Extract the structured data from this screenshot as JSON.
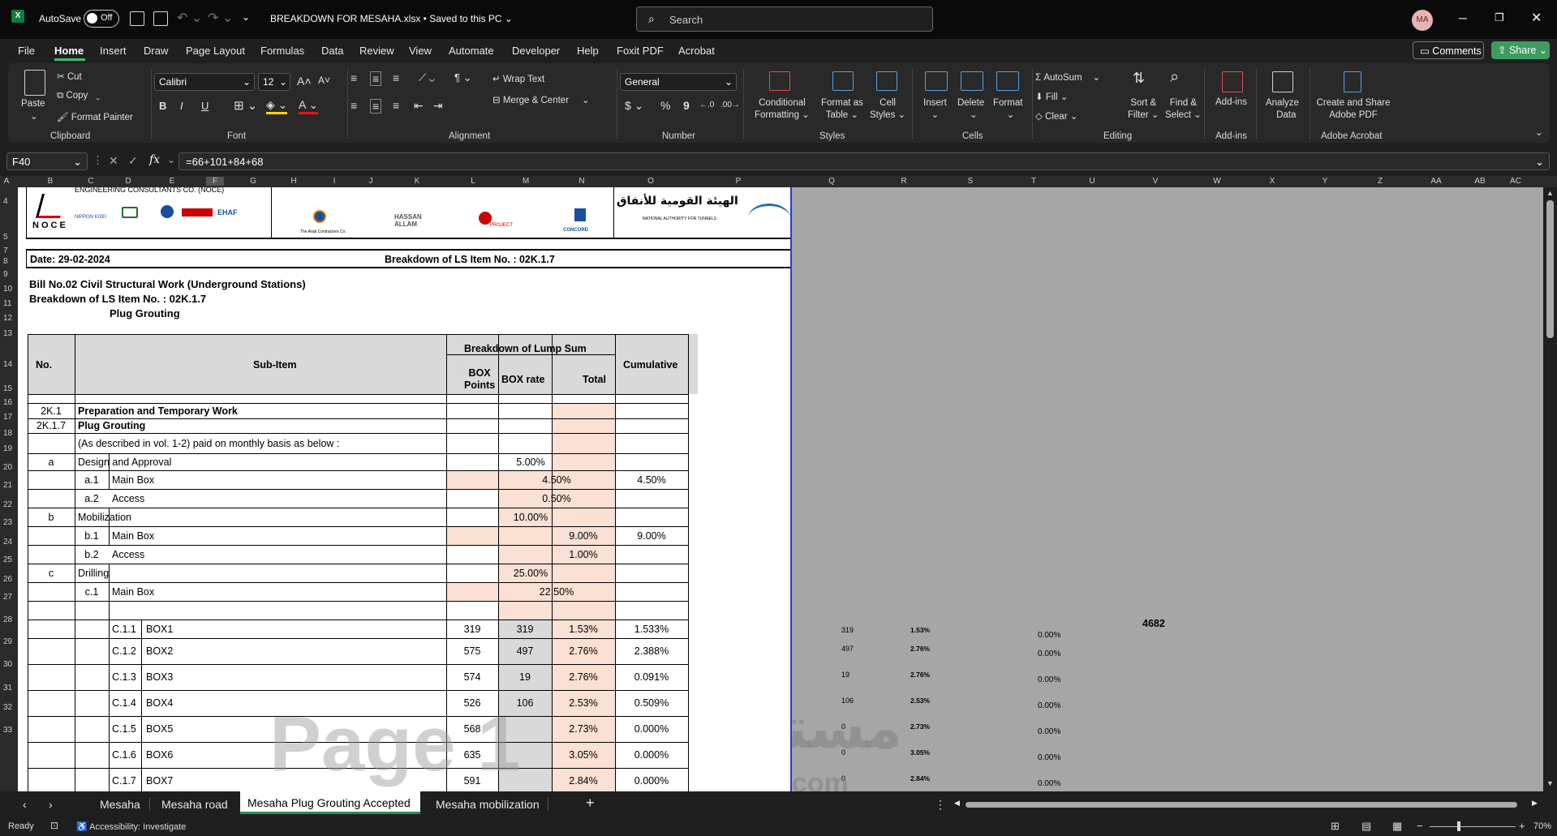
{
  "titlebar": {
    "autosave": "AutoSave",
    "toggle": "Off",
    "filename": "BREAKDOWN FOR MESAHA.xlsx • Saved to this PC ⌄",
    "search": "Search",
    "user": "MA"
  },
  "menu": {
    "tabs": [
      "File",
      "Home",
      "Insert",
      "Draw",
      "Page Layout",
      "Formulas",
      "Data",
      "Review",
      "View",
      "Automate",
      "Developer",
      "Help",
      "Foxit PDF",
      "Acrobat"
    ],
    "comments": "Comments",
    "share": "Share"
  },
  "ribbon": {
    "clipboard": {
      "paste": "Paste",
      "cut": "Cut",
      "copy": "Copy",
      "format_painter": "Format Painter",
      "group": "Clipboard"
    },
    "font": {
      "name": "Calibri",
      "size": "12",
      "bold": "B",
      "italic": "I",
      "underline": "U",
      "group": "Font"
    },
    "alignment": {
      "wrap": "Wrap Text",
      "merge": "Merge & Center",
      "group": "Alignment"
    },
    "number": {
      "format": "General",
      "currency": "$",
      "percent": "%",
      "comma": "9",
      "group": "Number"
    },
    "styles": {
      "conditional": "Conditional",
      "conditional2": "Formatting",
      "format_table": "Format as",
      "format_table2": "Table",
      "cell_styles": "Cell",
      "cell_styles2": "Styles",
      "group": "Styles"
    },
    "cells": {
      "insert": "Insert",
      "delete": "Delete",
      "format": "Format",
      "group": "Cells"
    },
    "editing": {
      "autosum": "AutoSum",
      "fill": "Fill",
      "clear": "Clear",
      "sort": "Sort &",
      "sort2": "Filter",
      "find": "Find &",
      "find2": "Select",
      "group": "Editing"
    },
    "addins": {
      "label": "Add-ins",
      "group": "Add-ins"
    },
    "analyze": {
      "label": "Analyze",
      "label2": "Data"
    },
    "acrobat": {
      "label": "Create and Share",
      "label2": "Adobe PDF",
      "group": "Adobe Acrobat"
    }
  },
  "formula_bar": {
    "cell_ref": "F40",
    "fx": "fx",
    "formula": "=66+101+84+68"
  },
  "columns": [
    "A",
    "B",
    "C",
    "D",
    "E",
    "F",
    "G",
    "H",
    "I",
    "J",
    "K",
    "L",
    "M",
    "N",
    "O",
    "P",
    "Q",
    "R",
    "S",
    "T",
    "U",
    "V",
    "W",
    "X",
    "Y",
    "Z",
    "AA",
    "AB",
    "AC"
  ],
  "rows": [
    "4",
    "5",
    "7",
    "8",
    "9",
    "10",
    "11",
    "12",
    "13",
    "14",
    "15",
    "16",
    "17",
    "18",
    "19",
    "20",
    "21",
    "22",
    "23",
    "24",
    "25",
    "26",
    "27",
    "28",
    "29",
    "30",
    "31",
    "32",
    "33"
  ],
  "sheet": {
    "logos": {
      "noce": "NOCE",
      "nippon": "NIPPON KOEI",
      "ehaf": "EHAF",
      "arab": "The Arab Contractors Co.",
      "hassan": "HASSAN ALLAM",
      "project": "PROJECT",
      "concord": "CONCORD",
      "nat_ar": "الهيئة القومية للأنفاق",
      "nat_en": "NATIONAL AUTHORITY FOR TUNNELS",
      "top_text": "ENGINEERING CONSULTANTS CO. (NOCE)"
    },
    "date": "Date: 29-02-2024",
    "breakdown_title": "Breakdown of LS Item No. : 02K.1.7",
    "bill": "Bill No.02 Civil Structural Work (Underground Stations)",
    "breakdown_line": "Breakdown of LS Item No. : 02K.1.7",
    "plug": "Plug Grouting",
    "headers": {
      "no": "No.",
      "subitem": "Sub-Item",
      "lump": "Breakdown of Lump Sum",
      "box_points": "BOX",
      "box_points2": "Points",
      "box_rate": "BOX rate",
      "total": "Total",
      "cumulative": "Cumulative"
    },
    "r16": {
      "no": "2K.1",
      "desc": "Preparation and Temporary Work"
    },
    "r17": {
      "no": "2K.1.7",
      "desc": "Plug Grouting"
    },
    "r18": {
      "desc": "(As described in vol. 1-2) paid on monthly basis as below :"
    },
    "r19": {
      "no": "a",
      "desc": "Design and Approval",
      "pct": "5.00%"
    },
    "r20": {
      "no": "a.1",
      "desc": "Main Box",
      "total": "4.50%",
      "cum": "4.50%"
    },
    "r21": {
      "no": "a.2",
      "desc": "Access",
      "total": "0.50%"
    },
    "r22": {
      "no": "b",
      "desc": "Mobilization",
      "pct": "10.00%"
    },
    "r23": {
      "no": "b.1",
      "desc": "Main Box",
      "total": "9.00%",
      "cum": "9.00%"
    },
    "r24": {
      "no": "b.2",
      "desc": "Access",
      "total": "1.00%"
    },
    "r25": {
      "no": "c",
      "desc": "Drilling",
      "pct": "25.00%"
    },
    "r26": {
      "no": "c.1",
      "desc": "Main Box",
      "total": "22.50%"
    },
    "boxes": [
      {
        "no": "C.1.1",
        "name": "BOX1",
        "points": "319",
        "rate": "319",
        "total": "1.53%",
        "cum": "1.533%"
      },
      {
        "no": "C.1.2",
        "name": "BOX2",
        "points": "575",
        "rate": "497",
        "total": "2.76%",
        "cum": "2.388%"
      },
      {
        "no": "C.1.3",
        "name": "BOX3",
        "points": "574",
        "rate": "19",
        "total": "2.76%",
        "cum": "0.091%"
      },
      {
        "no": "C.1.4",
        "name": "BOX4",
        "points": "526",
        "rate": "106",
        "total": "2.53%",
        "cum": "0.509%"
      },
      {
        "no": "C.1.5",
        "name": "BOX5",
        "points": "568",
        "rate": "",
        "total": "2.73%",
        "cum": "0.000%"
      },
      {
        "no": "C.1.6",
        "name": "BOX6",
        "points": "635",
        "rate": "",
        "total": "3.05%",
        "cum": "0.000%"
      },
      {
        "no": "C.1.7",
        "name": "BOX7",
        "points": "591",
        "rate": "",
        "total": "2.84%",
        "cum": "0.000%"
      }
    ],
    "page_watermark": "Page 1"
  },
  "gray_area": {
    "rows": [
      {
        "q": "319",
        "r": "1.53%",
        "t": "0.00%"
      },
      {
        "q": "497",
        "r": "2.76%",
        "t": "0.00%"
      },
      {
        "q": "19",
        "r": "2.76%",
        "t": "0.00%"
      },
      {
        "q": "106",
        "r": "2.53%",
        "t": "0.00%"
      },
      {
        "q": "0",
        "r": "2.73%",
        "t": "0.00%"
      },
      {
        "q": "0",
        "r": "3.05%",
        "t": "0.00%"
      },
      {
        "q": "0",
        "r": "2.84%",
        "t": "0.00%"
      }
    ],
    "v27": "4682"
  },
  "sheet_tabs": [
    "Mesaha",
    "Mesaha road",
    "Mesaha Plug Grouting Accepted",
    "Mesaha mobilization"
  ],
  "status": {
    "ready": "Ready",
    "accessibility": "Accessibility: Investigate",
    "zoom": "70%"
  },
  "watermark": {
    "ar": "مستقل",
    "en": "mostaql.com"
  }
}
